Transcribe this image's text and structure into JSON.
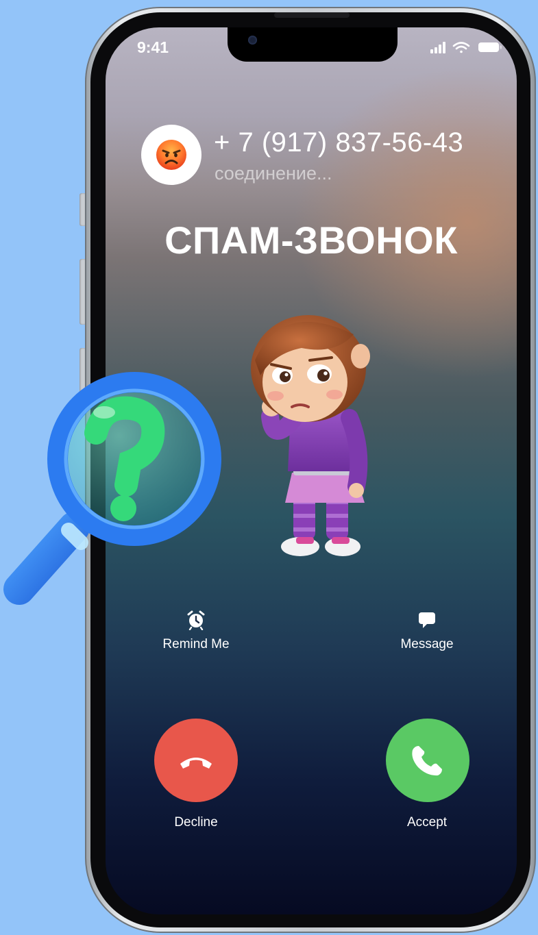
{
  "status_bar": {
    "time": "9:41"
  },
  "caller": {
    "avatar_icon": "angry-face-emoji-icon",
    "number": "+ 7 (917) 837-56-43",
    "status": "соединение..."
  },
  "headline": "СПАМ-ЗВОНОК",
  "actions": {
    "remind": {
      "label": "Remind Me",
      "icon": "alarm-clock-icon"
    },
    "message": {
      "label": "Message",
      "icon": "speech-bubble-icon"
    }
  },
  "call_buttons": {
    "decline": {
      "label": "Decline",
      "color": "#e8574b",
      "icon": "phone-hangup-icon"
    },
    "accept": {
      "label": "Accept",
      "color": "#5ac964",
      "icon": "phone-icon"
    }
  },
  "colors": {
    "background": "#93c4f9",
    "magnifier_blue": "#2c7bf0",
    "question_green": "#35d97a"
  }
}
